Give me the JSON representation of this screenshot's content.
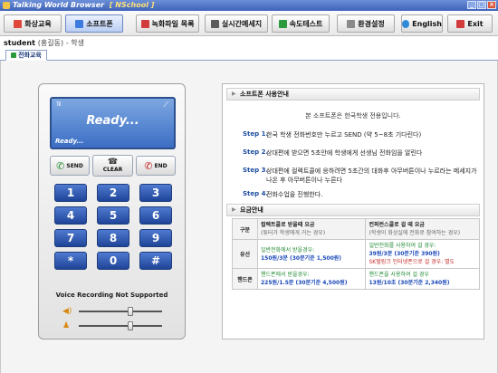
{
  "window": {
    "title": "Talking World Browser",
    "subtitle": "[ NSchool ]"
  },
  "toolbar": {
    "buttons": [
      {
        "label": "화상교육",
        "icon": "video-lesson-icon"
      },
      {
        "label": "소프트폰",
        "icon": "softphone-icon"
      },
      {
        "label": "녹화파일 목록",
        "icon": "recording-list-icon"
      },
      {
        "label": "실시간메세지",
        "icon": "message-icon"
      },
      {
        "label": "속도테스트",
        "icon": "speed-test-icon"
      },
      {
        "label": "환경설정",
        "icon": "settings-icon"
      },
      {
        "label": "English",
        "icon": "globe-icon"
      },
      {
        "label": "Exit",
        "icon": "exit-icon"
      }
    ]
  },
  "user": {
    "name": "student",
    "detail": "(홍길동)",
    "role": "- 학생"
  },
  "tabs": [
    {
      "label": "전화교육"
    }
  ],
  "phone": {
    "signal": "Tıl",
    "status_big": "Ready...",
    "status_small": "Ready...",
    "send_label": "SEND",
    "clear_label": "CLEAR",
    "end_label": "END",
    "keys": [
      "1",
      "2",
      "3",
      "4",
      "5",
      "6",
      "7",
      "8",
      "9",
      "*",
      "0",
      "#"
    ],
    "voice_recording_label": "Voice Recording Not Supported",
    "speaker_level": 0.62,
    "mic_level": 0.62
  },
  "usage": {
    "heading": "소프트폰 사용안내",
    "intro": "본 소프트폰은 한국학생 전용입니다.",
    "steps": [
      {
        "num": "Step 1.",
        "text": "한국 학생 전화번호만 누르고 SEND (약 5~8초 기다린다)"
      },
      {
        "num": "Step 2.",
        "text": "상대편에 받으면 5초안에 학생에게 선생님 전화임을 알린다"
      },
      {
        "num": "Step 3.",
        "text": "상대편에 컬렉트콜에 응하려면 5초간의 대화후 아무버튼이나 누르라는 메세지가 나온 후 아무버튼이나 누른다"
      },
      {
        "num": "Step 4.",
        "text": "전화수업을 진행한다."
      }
    ]
  },
  "rates": {
    "heading": "요금안내",
    "col_label": "구분",
    "col1_title": "컬렉트콜로 받을때 요금",
    "col1_sub": "(튜터가 학생에게 거는 경우)",
    "col2_title": "컨퍼런스콜로 걸 때 요금",
    "col2_sub": "(학생이 화상실에 전화로 참여하는 경우)",
    "rows": [
      {
        "label": "유선",
        "col1": [
          {
            "text": "일반전화에서 받을경우:",
            "tone": "g"
          },
          {
            "text": "150원/3분 (30분기준 1,500원)",
            "tone": "b"
          }
        ],
        "col2": [
          {
            "text": "일반전화를 사용하여 걸 경우:",
            "tone": "g"
          },
          {
            "text": "39원/3분 (30분기준 390원)",
            "tone": "b"
          },
          {
            "text": "SK텔링크 인터넷폰으로 걸 경우: 별도",
            "tone": "r"
          }
        ]
      },
      {
        "label": "핸드폰",
        "col1": [
          {
            "text": "핸드폰에서 받을경우:",
            "tone": "g"
          },
          {
            "text": "225원/1.5분 (30분기준 4,500원)",
            "tone": "b"
          }
        ],
        "col2": [
          {
            "text": "핸드폰을 사용하여 걸 경우",
            "tone": "g"
          },
          {
            "text": "13원/10초 (30분기준 2,340원)",
            "tone": "b"
          }
        ]
      }
    ]
  }
}
